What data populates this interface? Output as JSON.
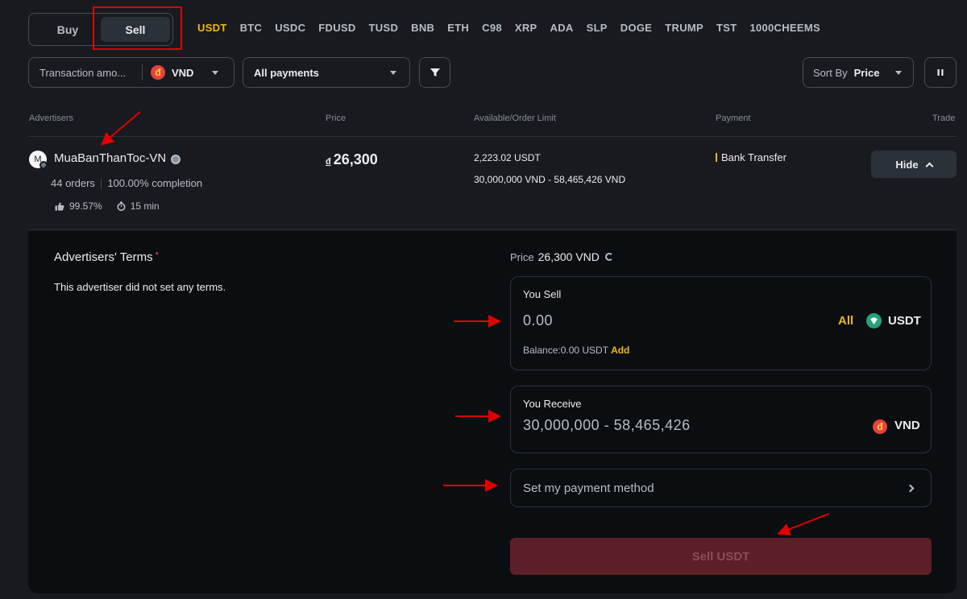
{
  "tabs": {
    "buy": "Buy",
    "sell": "Sell"
  },
  "coins": [
    "USDT",
    "BTC",
    "USDC",
    "FDUSD",
    "TUSD",
    "BNB",
    "ETH",
    "C98",
    "XRP",
    "ADA",
    "SLP",
    "DOGE",
    "TRUMP",
    "TST",
    "1000CHEEMS"
  ],
  "active_coin": "USDT",
  "filters": {
    "amount_placeholder": "Transaction amo...",
    "currency": "VND",
    "currency_symbol": "đ",
    "payments": "All payments",
    "sort_label": "Sort By",
    "sort_value": "Price"
  },
  "table_headers": {
    "advertisers": "Advertisers",
    "price": "Price",
    "available": "Available/Order Limit",
    "payment": "Payment",
    "trade": "Trade"
  },
  "ad": {
    "avatar_letter": "M",
    "name": "MuaBanThanToc-VN",
    "orders": "44 orders",
    "completion": "100.00% completion",
    "positive_rate": "99.57%",
    "release_time": "15 min",
    "price_symbol": "đ",
    "price": "26,300",
    "available": "2,223.02 USDT",
    "limit": "30,000,000 VND - 58,465,426 VND",
    "payment": "Bank Transfer",
    "hide_label": "Hide"
  },
  "panel": {
    "terms_title": "Advertisers' Terms",
    "terms_asterisk": "*",
    "terms_text": "This advertiser did not set any terms.",
    "price_label": "Price",
    "price_value": "26,300 VND",
    "you_sell_label": "You Sell",
    "you_sell_value": "0.00",
    "all_label": "All",
    "sell_currency": "USDT",
    "balance_text": "Balance:0.00 USDT",
    "add_label": "Add",
    "you_receive_label": "You Receive",
    "you_receive_value": "30,000,000 - 58,465,426",
    "receive_currency": "VND",
    "receive_symbol": "đ",
    "payment_method_label": "Set my payment method",
    "submit_label": "Sell USDT"
  },
  "colors": {
    "accent": "#f0b90b",
    "sell_button": "#5c1f28",
    "annotation": "#e10000"
  }
}
